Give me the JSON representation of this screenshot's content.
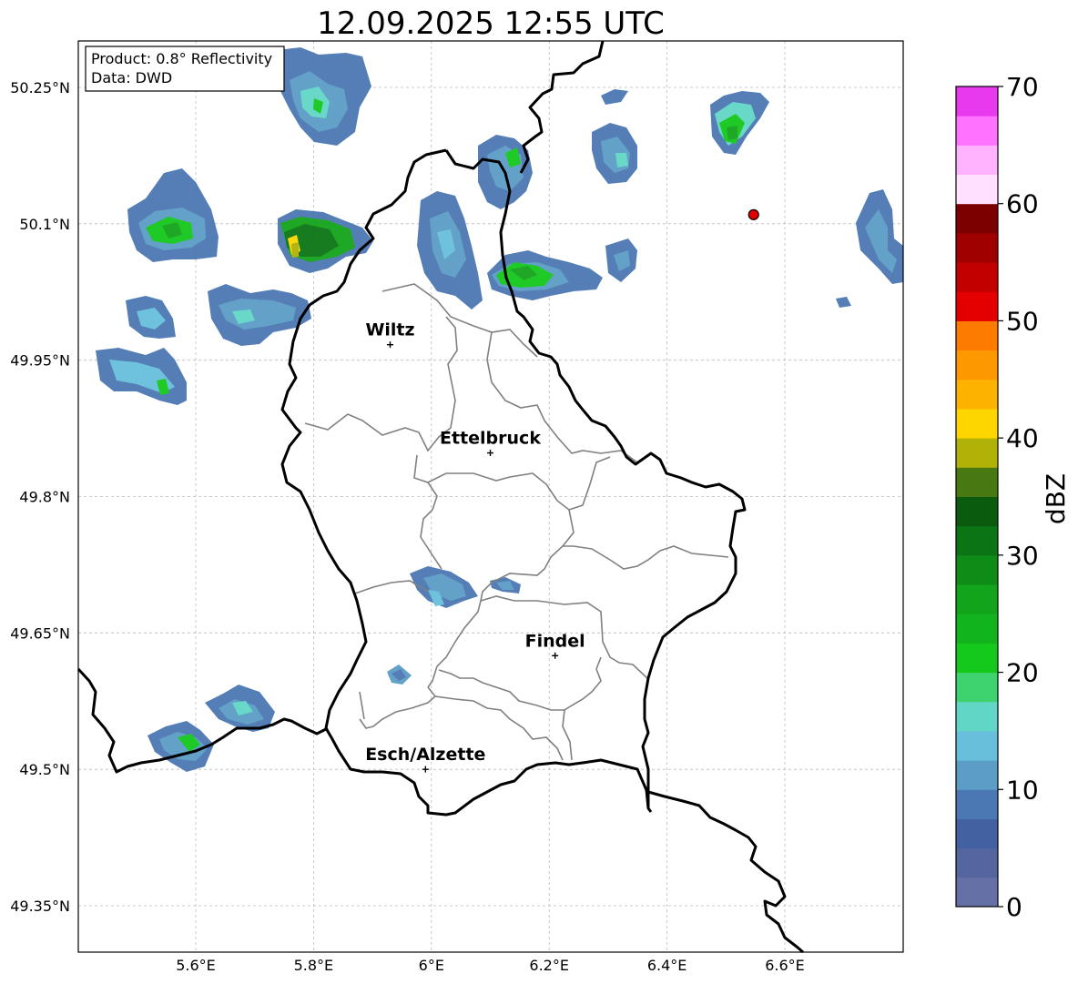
{
  "map": {
    "title": "12.09.2025 12:55 UTC",
    "info_box": {
      "product": "Product: 0.8° Reflectivity",
      "source": "Data: DWD"
    },
    "lon_range": [
      5.4,
      6.8
    ],
    "lat_range": [
      49.3,
      50.3
    ],
    "lon_ticks": [
      {
        "value": 5.6,
        "label": "5.6°E"
      },
      {
        "value": 5.8,
        "label": "5.8°E"
      },
      {
        "value": 6.0,
        "label": "6°E"
      },
      {
        "value": 6.2,
        "label": "6.2°E"
      },
      {
        "value": 6.4,
        "label": "6.4°E"
      },
      {
        "value": 6.6,
        "label": "6.6°E"
      }
    ],
    "lat_ticks": [
      {
        "value": 50.25,
        "label": "50.25°N"
      },
      {
        "value": 50.1,
        "label": "50.1°N"
      },
      {
        "value": 49.95,
        "label": "49.95°N"
      },
      {
        "value": 49.8,
        "label": "49.8°N"
      },
      {
        "value": 49.65,
        "label": "49.65°N"
      },
      {
        "value": 49.5,
        "label": "49.5°N"
      },
      {
        "value": 49.35,
        "label": "49.35°N"
      }
    ],
    "cities": [
      {
        "name": "Wiltz",
        "lon": 5.93,
        "lat": 49.967
      },
      {
        "name": "Ettelbruck",
        "lon": 6.1,
        "lat": 49.848
      },
      {
        "name": "Findel",
        "lon": 6.21,
        "lat": 49.625
      },
      {
        "name": "Esch/Alzette",
        "lon": 5.99,
        "lat": 49.5
      }
    ],
    "radar_site": {
      "lon": 6.547,
      "lat": 50.11,
      "color": "#e00000"
    }
  },
  "colorbar": {
    "label": "dBZ",
    "min": 0,
    "max": 70,
    "ticks": [
      "0",
      "10",
      "20",
      "30",
      "40",
      "50",
      "60",
      "70"
    ],
    "colors": [
      "#6571a6",
      "#5465a0",
      "#4361a1",
      "#4b78b2",
      "#5b9dc7",
      "#67bfdc",
      "#62d6c6",
      "#3ed36f",
      "#14c81c",
      "#12b41d",
      "#12a41b",
      "#0f8b17",
      "#0b7414",
      "#0a5b0e",
      "#487811",
      "#b0b208",
      "#fdd600",
      "#fdb200",
      "#fd9800",
      "#fd7c00",
      "#e40000",
      "#c30000",
      "#a00000",
      "#7d0000",
      "#ffe0ff",
      "#ffb3ff",
      "#ff72ff",
      "#e839ee"
    ]
  }
}
